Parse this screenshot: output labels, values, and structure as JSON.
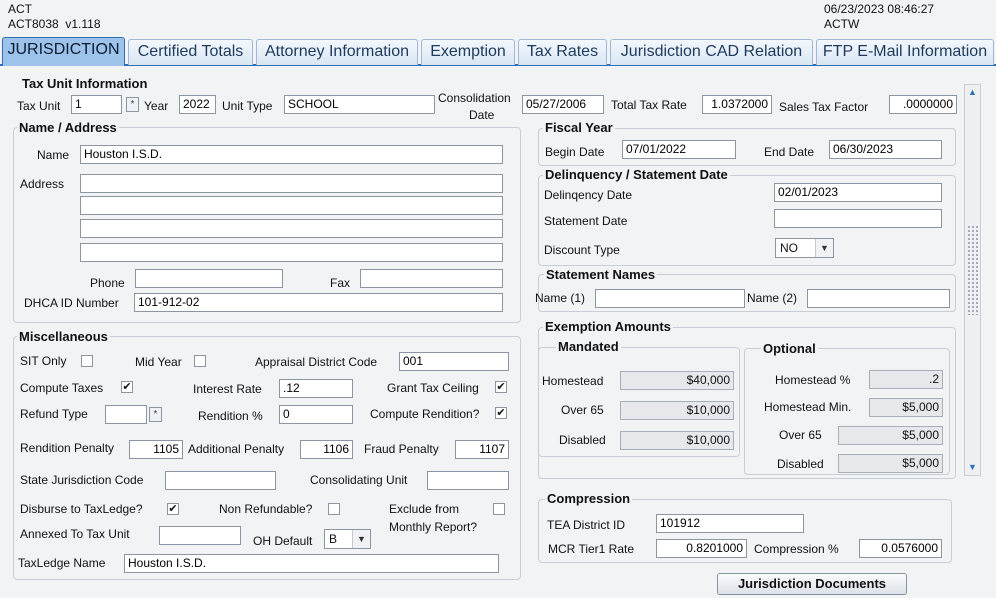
{
  "header": {
    "app": "ACT",
    "form_id": "ACT8038",
    "version": "v1.118",
    "datetime": "06/23/2023 08:46:27",
    "user": "ACTW"
  },
  "tabs": [
    {
      "label": "JURISDICTION",
      "active": true
    },
    {
      "label": "Certified Totals"
    },
    {
      "label": "Attorney Information"
    },
    {
      "label": "Exemption"
    },
    {
      "label": "Tax Rates"
    },
    {
      "label": "Jurisdiction CAD Relation"
    },
    {
      "label": "FTP E-Mail Information"
    }
  ],
  "tax_unit_info": {
    "title": "Tax Unit Information",
    "tax_unit_label": "Tax Unit",
    "tax_unit": "1",
    "year_label": "Year",
    "year": "2022",
    "unit_type_label": "Unit Type",
    "unit_type": "SCHOOL",
    "consolidation_label_1": "Consolidation",
    "consolidation_label_2": "Date",
    "consolidation_date": "05/27/2006",
    "total_tax_rate_label": "Total Tax Rate",
    "total_tax_rate": "1.0372000",
    "sales_tax_label": "Sales Tax Factor",
    "sales_tax_factor": ".0000000"
  },
  "name_address": {
    "title": "Name / Address",
    "name_label": "Name",
    "name": "Houston I.S.D.",
    "address_label": "Address",
    "address_lines": [
      "",
      "",
      "",
      ""
    ],
    "phone_label": "Phone",
    "phone": "",
    "fax_label": "Fax",
    "fax": "",
    "dhca_label": "DHCA ID Number",
    "dhca": "101-912-02"
  },
  "misc": {
    "title": "Miscellaneous",
    "sit_only_label": "SIT Only",
    "sit_only": false,
    "mid_year_label": "Mid Year",
    "mid_year": false,
    "appraisal_label": "Appraisal District Code",
    "appraisal_code": "001",
    "compute_taxes_label": "Compute Taxes",
    "compute_taxes": true,
    "interest_rate_label": "Interest Rate",
    "interest_rate": ".12",
    "grant_ceiling_label": "Grant Tax Ceiling",
    "grant_ceiling": true,
    "refund_type_label": "Refund Type",
    "refund_type": "",
    "rendition_pct_label": "Rendition %",
    "rendition_pct": "0",
    "compute_rendition_label": "Compute Rendition?",
    "compute_rendition": true,
    "rendition_penalty_label": "Rendition Penalty",
    "rendition_penalty": "1105",
    "additional_penalty_label": "Additional Penalty",
    "additional_penalty": "1106",
    "fraud_penalty_label": "Fraud Penalty",
    "fraud_penalty": "1107",
    "state_juris_label": "State Jurisdiction Code",
    "state_juris": "",
    "consolidating_label": "Consolidating Unit",
    "consolidating": "",
    "disburse_label": "Disburse to TaxLedge?",
    "disburse": true,
    "non_refundable_label": "Non Refundable?",
    "non_refundable": false,
    "exclude_label_1": "Exclude from",
    "exclude_label_2": "Monthly Report?",
    "exclude": false,
    "annexed_label": "Annexed To Tax Unit",
    "annexed": "",
    "oh_default_label": "OH Default",
    "oh_default": "B",
    "taxledge_label": "TaxLedge Name",
    "taxledge_name": "Houston I.S.D."
  },
  "fiscal_year": {
    "title": "Fiscal Year",
    "begin_label": "Begin Date",
    "begin": "07/01/2022",
    "end_label": "End Date",
    "end": "06/30/2023"
  },
  "delinquency": {
    "title": "Delinquency / Statement Date",
    "delinq_label": "Delinqency Date",
    "delinq": "02/01/2023",
    "statement_label": "Statement Date",
    "statement": "",
    "discount_label": "Discount Type",
    "discount": "NO"
  },
  "statement_names": {
    "title": "Statement Names",
    "name1_label": "Name (1)",
    "name1": "",
    "name2_label": "Name (2)",
    "name2": ""
  },
  "exemptions": {
    "title": "Exemption Amounts",
    "mandated_title": "Mandated",
    "homestead_label": "Homestead",
    "homestead": "$40,000",
    "over65_label": "Over 65",
    "over65": "$10,000",
    "disabled_label": "Disabled",
    "disabled": "$10,000",
    "optional_title": "Optional",
    "homestead_pct_label": "Homestead %",
    "homestead_pct": ".2",
    "homestead_min_label": "Homestead Min.",
    "homestead_min": "$5,000",
    "opt_over65_label": "Over 65",
    "opt_over65": "$5,000",
    "opt_disabled_label": "Disabled",
    "opt_disabled": "$5,000"
  },
  "compression": {
    "title": "Compression",
    "tea_label": "TEA District ID",
    "tea": "101912",
    "mcr_label": "MCR Tier1 Rate",
    "mcr": "0.8201000",
    "comp_pct_label": "Compression %",
    "comp_pct": "0.0576000"
  },
  "buttons": {
    "documents": "Jurisdiction Documents"
  },
  "icons": {
    "lov": "list-of-values-icon",
    "check": "checkmark-icon",
    "dropdown": "chevron-down-icon"
  }
}
